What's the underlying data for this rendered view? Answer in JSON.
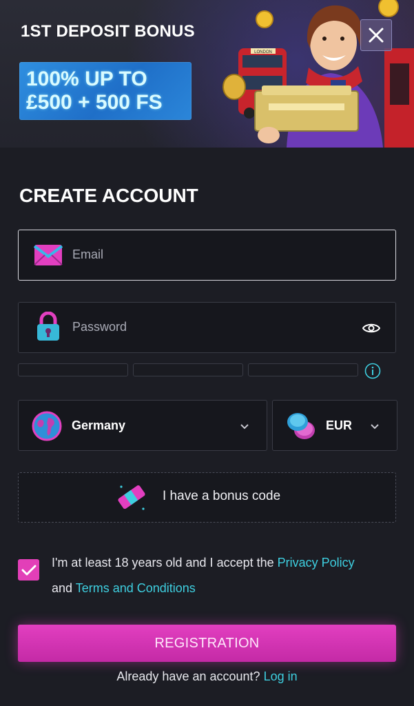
{
  "banner": {
    "title": "1ST DEPOSIT BONUS",
    "offer_line_1": "100% UP TO",
    "offer_line_2": "£500 + 500 FS",
    "bus_sign": "LONDON"
  },
  "form": {
    "heading": "CREATE ACCOUNT",
    "email_placeholder": "Email",
    "password_placeholder": "Password",
    "country_value": "Germany",
    "currency_value": "EUR",
    "bonus_label": "I have a bonus code",
    "terms_prefix": "I'm at least 18 years old and I accept the ",
    "privacy_link": "Privacy Policy",
    "terms_middle": "and ",
    "terms_link": "Terms and Conditions",
    "terms_checked": true,
    "register_label": "REGISTRATION",
    "login_prompt": "Already have an account?",
    "login_link": "Log in"
  },
  "colors": {
    "accent_pink": "#e23fc0",
    "link_cyan": "#3ecfe0",
    "offer_blue": "#2f8fe0"
  }
}
